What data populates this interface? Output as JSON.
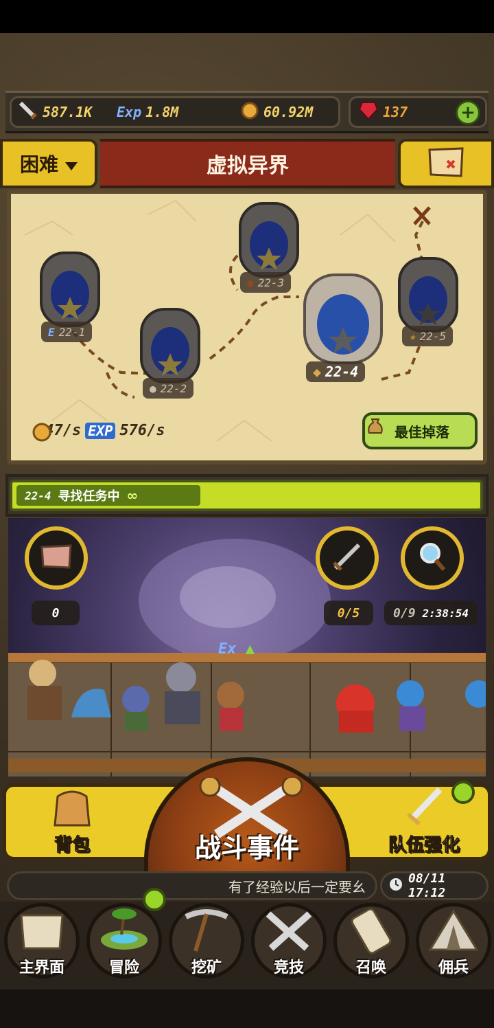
{
  "resources": {
    "power": "587.1K",
    "exp_label": "Exp",
    "exp": "1.8M",
    "gold": "60.92M",
    "gems": "137"
  },
  "header": {
    "difficulty": "困难",
    "title": "虚拟异界"
  },
  "map": {
    "portals": [
      {
        "id": "22-1",
        "tag": "E"
      },
      {
        "id": "22-2"
      },
      {
        "id": "22-3"
      },
      {
        "id": "22-4"
      },
      {
        "id": "22-5"
      }
    ],
    "gold_rate": "347/s",
    "exp_badge": "EXP",
    "exp_rate": "576/s",
    "best_drop": "最佳掉落"
  },
  "quest": {
    "level": "22-4",
    "status": "寻找任务中",
    "repeat": "∞"
  },
  "battle": {
    "scroll_count": "0",
    "kill_count": "0/5",
    "search_count": "0/9",
    "timer": "2:38:54",
    "exp_popup": "Ex"
  },
  "actions": {
    "bag": "背包",
    "battle_event": "战斗事件",
    "team_upgrade": "队伍强化"
  },
  "ticker": {
    "message": "有了经验以后一定要幺",
    "clock": "08/11 17:12"
  },
  "nav": {
    "items": [
      "主界面",
      "冒险",
      "挖矿",
      "竞技",
      "召唤",
      "佣兵"
    ]
  },
  "colors": {
    "accent_yellow": "#e8c126",
    "banner_red": "#8a2a1b",
    "quest_green": "#c6dd28",
    "notify_green": "#9ad62a"
  }
}
